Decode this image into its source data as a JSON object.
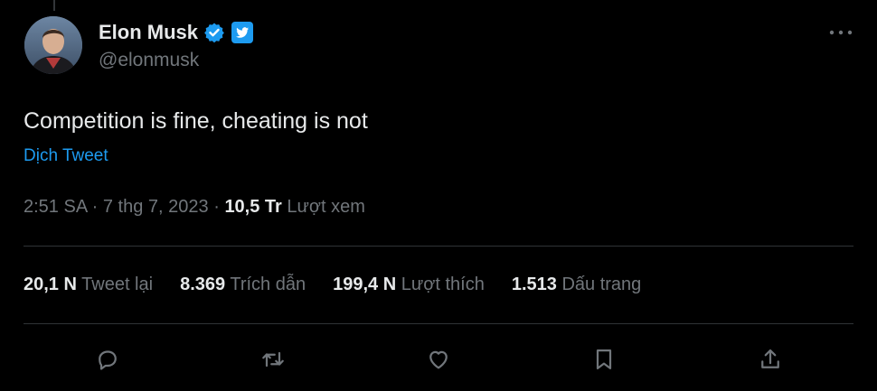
{
  "author": {
    "name": "Elon Musk",
    "handle": "@elonmusk",
    "verified_icon": "verified-badge-icon",
    "badge_icon": "twitter-bird-icon"
  },
  "tweet": {
    "text": "Competition is fine, cheating is not",
    "translate_label": "Dịch Tweet",
    "time": "2:51 SA",
    "separator": "·",
    "date": "7 thg 7, 2023",
    "views_count": "10,5 Tr",
    "views_label": "Lượt xem"
  },
  "stats": [
    {
      "count": "20,1 N",
      "label": "Tweet lại"
    },
    {
      "count": "8.369",
      "label": "Trích dẫn"
    },
    {
      "count": "199,4 N",
      "label": "Lượt thích"
    },
    {
      "count": "1.513",
      "label": "Dấu trang"
    }
  ],
  "actions": [
    "reply-icon",
    "retweet-icon",
    "like-icon",
    "bookmark-icon",
    "share-icon"
  ],
  "colors": {
    "background": "#000000",
    "text": "#e7e9ea",
    "muted": "#71767b",
    "accent": "#1d9bf0",
    "divider": "#2f3336"
  }
}
